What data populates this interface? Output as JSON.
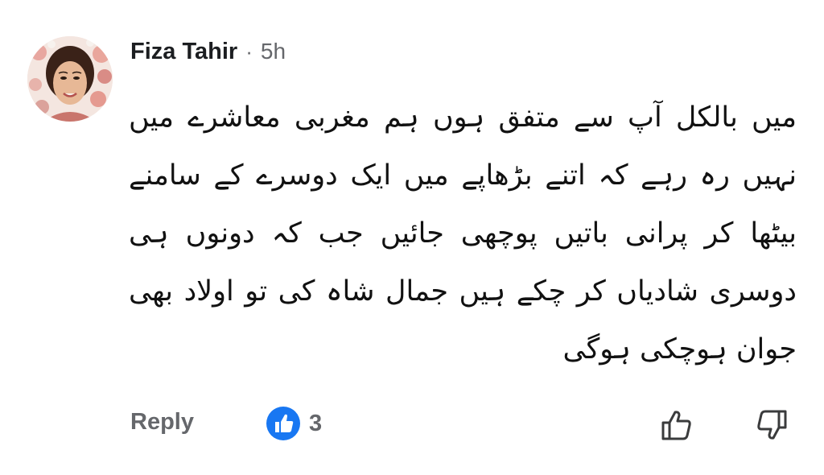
{
  "comment": {
    "author": "Fiza Tahir",
    "separator": "·",
    "time": "5h",
    "avatar_icon": "profile-photo",
    "text_lines": [
      "میں بالکل آپ سے متفق ہوں ہم مغربی معاشرے میں",
      "نہیں رہ رہے کہ اتنے بڑھاپے میں ایک دوسرے کے سامنے",
      "بیٹھا کر پرانی باتیں پوچھی جائیں جب کہ دونوں ہی",
      "دوسری شادیاں کر چکے ہیں جمال شاہ کی تو اولاد بھی",
      "جوان ہوچکی ہوگی"
    ]
  },
  "footer": {
    "reply_label": "Reply",
    "reaction_icon": "like-icon",
    "reaction_count": "3",
    "upvote_icon": "thumbs-up-outline-icon",
    "downvote_icon": "thumbs-down-outline-icon"
  },
  "colors": {
    "author": "#1c1e21",
    "secondary": "#65676b",
    "like_blue": "#1877f2",
    "body_text": "#111111"
  }
}
